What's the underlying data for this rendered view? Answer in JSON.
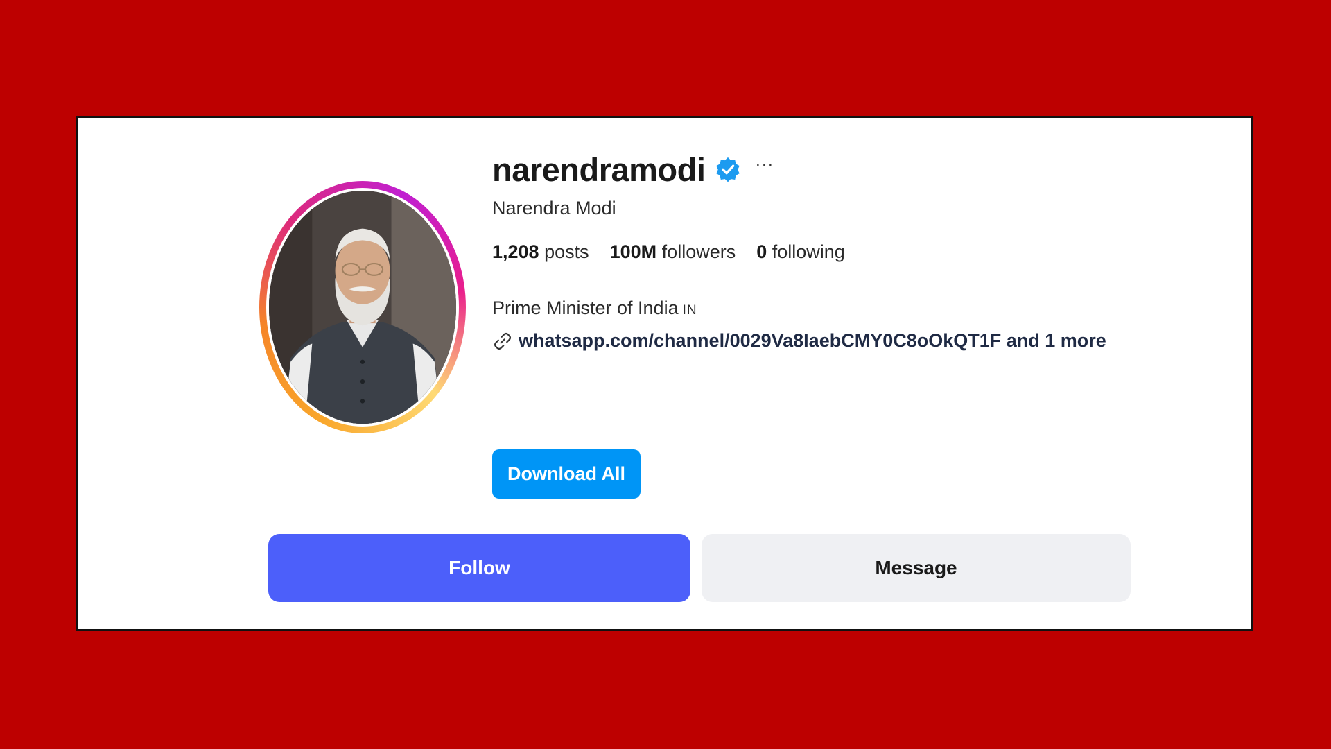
{
  "profile": {
    "username": "narendramodi",
    "full_name": "Narendra Modi",
    "verified_icon": "verified-badge-icon",
    "more_label": "···"
  },
  "stats": {
    "posts_count": "1,208",
    "posts_label": " posts",
    "followers_count": "100M",
    "followers_label": " followers",
    "following_count": "0",
    "following_label": " following"
  },
  "bio": {
    "text": "Prime Minister of India",
    "flag": "IN",
    "link_icon": "link-icon",
    "link_text": "whatsapp.com/channel/0029Va8IaebCMY0C8oOkQT1F and 1 more"
  },
  "actions": {
    "download_all_label": "Download All",
    "follow_label": "Follow",
    "message_label": "Message"
  },
  "colors": {
    "page_background": "#bd0000",
    "follow_button": "#4c5ffa",
    "download_button": "#0095f6",
    "message_button": "#eff0f3",
    "verified_badge": "#1d9bf0"
  }
}
